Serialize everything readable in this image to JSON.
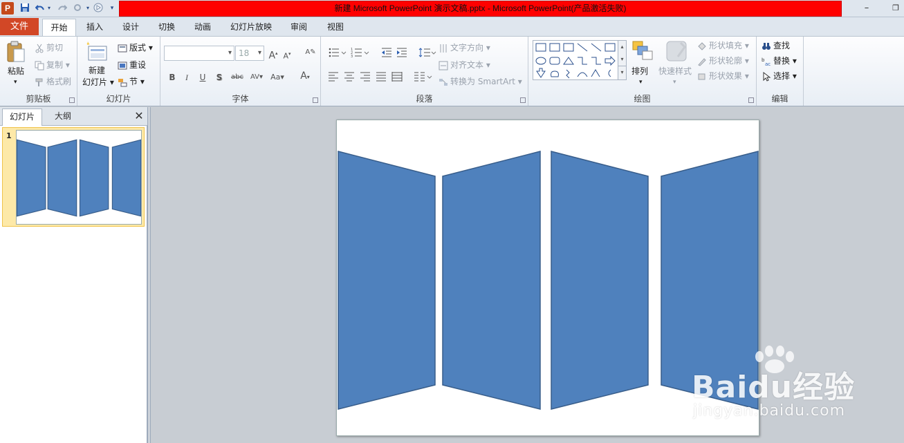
{
  "window": {
    "title": "新建 Microsoft PowerPoint 演示文稿.pptx - Microsoft PowerPoint(产品激活失败)",
    "app_icon_letter": "P",
    "minimize_glyph": "–",
    "restore_glyph": "❐"
  },
  "tabs": {
    "file": "文件",
    "items": [
      "开始",
      "插入",
      "设计",
      "切换",
      "动画",
      "幻灯片放映",
      "审阅",
      "视图"
    ]
  },
  "ribbon": {
    "clipboard": {
      "label": "剪贴板",
      "paste": "粘贴",
      "cut": "剪切",
      "copy": "复制",
      "format_painter": "格式刷"
    },
    "slides": {
      "label": "幻灯片",
      "new_slide_line1": "新建",
      "new_slide_line2": "幻灯片",
      "layout": "版式",
      "reset": "重设",
      "section": "节"
    },
    "font": {
      "label": "字体",
      "font_name": "",
      "font_size": "18"
    },
    "paragraph": {
      "label": "段落",
      "text_direction": "文字方向",
      "align_text": "对齐文本",
      "convert_smartart": "转换为 SmartArt"
    },
    "drawing": {
      "label": "绘图",
      "arrange": "排列",
      "quick_styles": "快速样式",
      "shape_fill": "形状填充",
      "shape_outline": "形状轮廓",
      "shape_effects": "形状效果"
    },
    "editing": {
      "label": "编辑",
      "find": "查找",
      "replace": "替换",
      "select": "选择"
    }
  },
  "panel": {
    "tab_slides": "幻灯片",
    "tab_outline": "大纲",
    "slide_number": "1"
  },
  "slide": {
    "shape_color": "#4f81bd",
    "shape_outline_color": "#385d8a",
    "shape_count": 4
  },
  "watermark": {
    "logo": "Baidu经验",
    "url": "jingyan.baidu.com"
  },
  "colors": {
    "title_bar_highlight": "#ff0000",
    "file_tab": "#d24726"
  }
}
